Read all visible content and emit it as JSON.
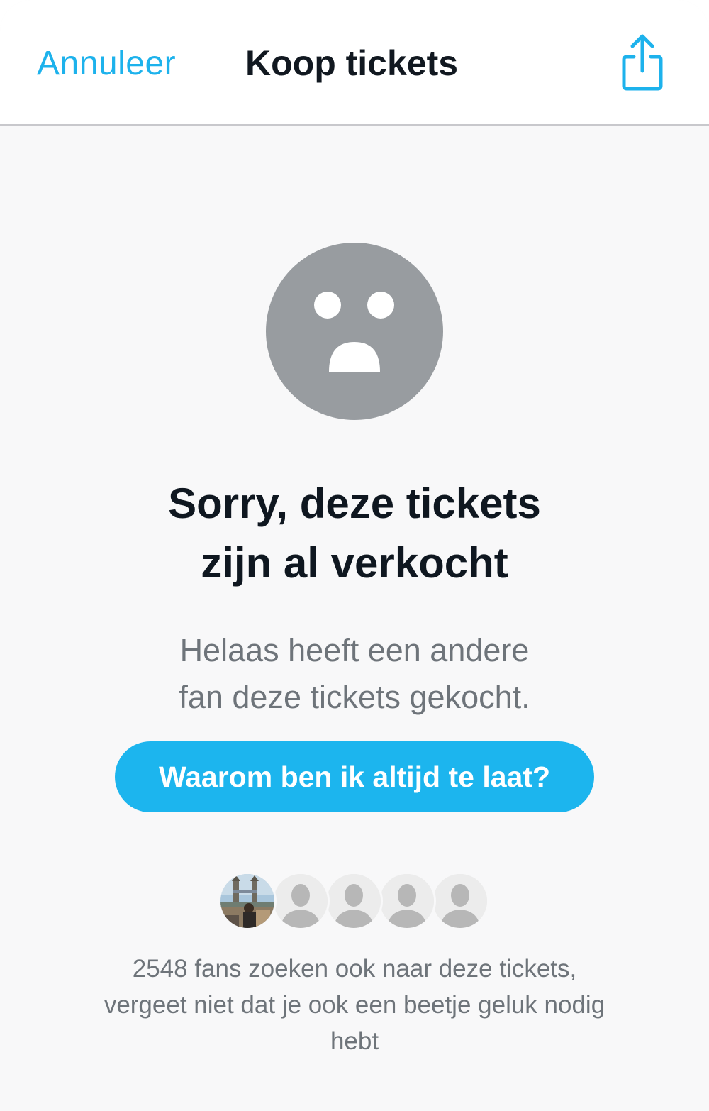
{
  "header": {
    "cancel_label": "Annuleer",
    "title": "Koop tickets",
    "share_icon": "share-icon"
  },
  "status": {
    "icon": "sad-face-icon",
    "headline_line1": "Sorry, deze tickets",
    "headline_line2": "zijn al verkocht",
    "message_line1": "Helaas heeft een andere",
    "message_line2": "fan deze tickets gekocht."
  },
  "cta": {
    "label": "Waarom ben ik altijd te laat?"
  },
  "fans": {
    "avatars": [
      "photo-avatar",
      "placeholder-avatar",
      "placeholder-avatar",
      "placeholder-avatar",
      "placeholder-avatar"
    ],
    "line1": "2548 fans zoeken ook naar deze tickets,",
    "line2": "vergeet niet dat je ook een beetje geluk nodig",
    "line3": "hebt"
  },
  "colors": {
    "accent": "#1cb5ee",
    "background": "#f8f8f9",
    "face": "#989ca0",
    "text_dark": "#0f1720",
    "text_muted": "#6e747a"
  }
}
